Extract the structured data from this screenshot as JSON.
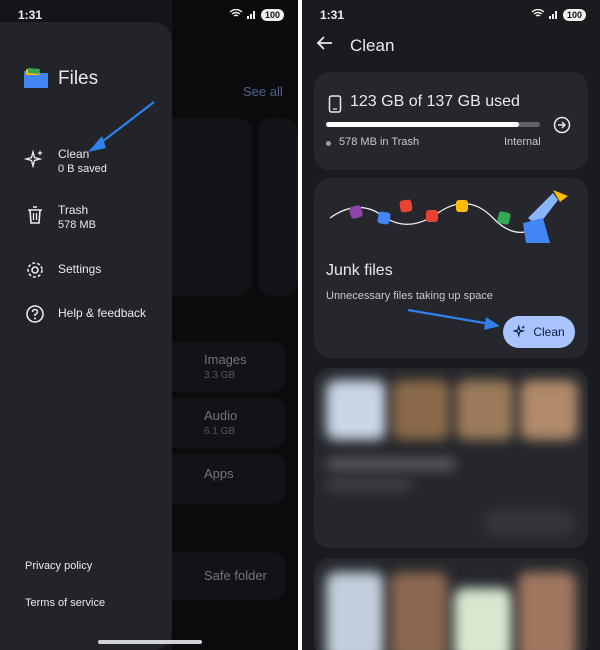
{
  "left": {
    "status": {
      "time": "1:31",
      "battery": "100"
    },
    "background": {
      "see_all": "See all",
      "categories": [
        {
          "label": "Images",
          "size": "3.3 GB"
        },
        {
          "label": "Audio",
          "size": "6.1 GB"
        },
        {
          "label": "Apps",
          "size": ""
        }
      ],
      "safe_folder": "Safe folder"
    },
    "drawer": {
      "app_name": "Files",
      "items": [
        {
          "label": "Clean",
          "sub": "0 B saved",
          "icon": "sparkle-icon"
        },
        {
          "label": "Trash",
          "sub": "578 MB",
          "icon": "trash-icon"
        },
        {
          "label": "Settings",
          "sub": "",
          "icon": "gear-icon"
        },
        {
          "label": "Help & feedback",
          "sub": "",
          "icon": "help-icon"
        }
      ],
      "links": [
        "Privacy policy",
        "Terms of service"
      ]
    }
  },
  "right": {
    "status": {
      "time": "1:31",
      "battery": "100"
    },
    "header": {
      "title": "Clean"
    },
    "storage": {
      "used_label": "123 GB of 137 GB used",
      "used_fraction": 0.9,
      "trash": "578 MB in Trash",
      "location": "Internal"
    },
    "junk": {
      "title": "Junk files",
      "description": "Unnecessary files taking up space",
      "button": "Clean"
    }
  },
  "colors": {
    "accent": "#aac4ff",
    "arrow": "#2f80ed"
  }
}
